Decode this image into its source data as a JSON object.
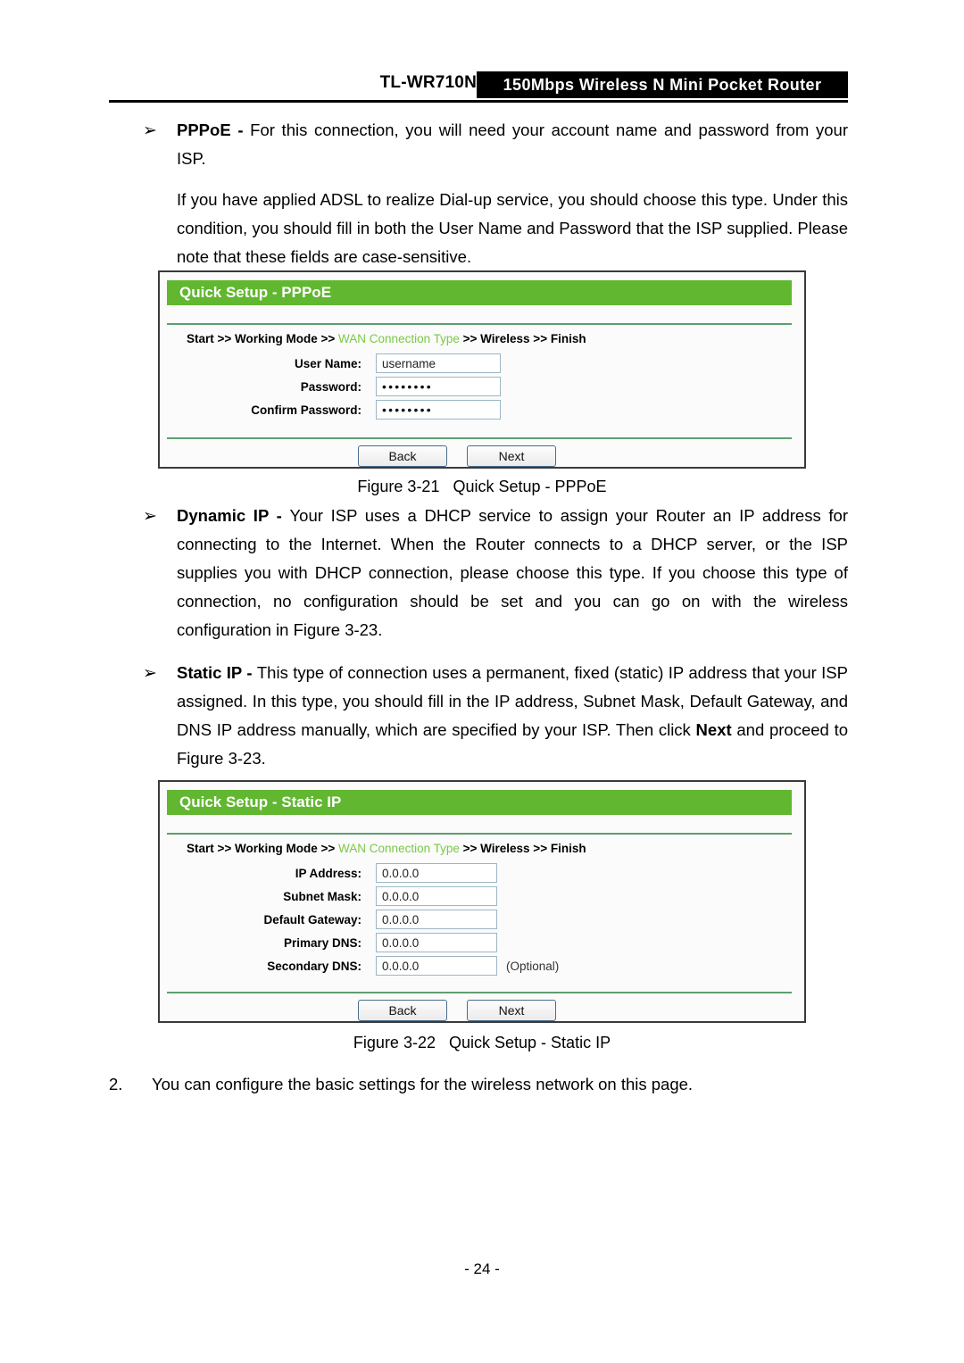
{
  "header": {
    "model": "TL-WR710N",
    "banner": "150Mbps Wireless N Mini Pocket Router"
  },
  "content": {
    "bullet_pppoe_label": "PPPoE - ",
    "bullet_pppoe_text": "For this connection, you will need your account name and password from your ISP.",
    "para_pppoe": "If you have applied ADSL to realize Dial-up service, you should choose this type. Under this condition, you should fill in both the User Name and Password that the ISP supplied. Please note that these fields are case-sensitive.",
    "bullet_dynamic_label": "Dynamic IP - ",
    "bullet_dynamic_text": "Your ISP uses a DHCP service to assign your Router an IP address for connecting to the Internet. When the Router connects to a DHCP server, or the ISP supplies you with DHCP connection, please choose this type. If you choose this type of connection, no configuration should be set and you can go on with the wireless configuration in Figure 3-23.",
    "bullet_static_label": "Static IP - ",
    "bullet_static_text_a": "This type of connection uses a permanent, fixed (static) IP address that your ISP assigned. In this type, you should fill in the IP address, Subnet Mask, Default Gateway, and DNS IP address manually, which are specified by your ISP. Then click ",
    "bullet_static_bold_next": "Next",
    "bullet_static_text_b": " and proceed to Figure 3-23.",
    "item_number": "2.",
    "item_text": "You can configure the basic settings for the wireless network on this page.",
    "page_number": "- 24 -"
  },
  "figure_21": {
    "caption_number": "Figure 3-21",
    "caption_title": "Quick Setup - PPPoE",
    "panel_title": "Quick Setup - PPPoE",
    "breadcrumb": {
      "part1": "Start >> Working Mode >> ",
      "highlight": "WAN Connection Type",
      "part2": " >> Wireless >> Finish"
    },
    "fields": [
      {
        "label": "User Name:",
        "value": "username",
        "type": "text"
      },
      {
        "label": "Password:",
        "value": "••••••••",
        "type": "password"
      },
      {
        "label": "Confirm Password:",
        "value": "••••••••",
        "type": "password"
      }
    ],
    "buttons": {
      "back": "Back",
      "next": "Next"
    }
  },
  "figure_22": {
    "caption_number": "Figure 3-22",
    "caption_title": "Quick Setup - Static IP",
    "panel_title": "Quick Setup - Static IP",
    "breadcrumb": {
      "part1": "Start >> Working Mode >> ",
      "highlight": "WAN Connection Type",
      "part2": " >> Wireless >> Finish"
    },
    "fields": [
      {
        "label": "IP Address:",
        "value": "0.0.0.0",
        "note": ""
      },
      {
        "label": "Subnet Mask:",
        "value": "0.0.0.0",
        "note": ""
      },
      {
        "label": "Default Gateway:",
        "value": "0.0.0.0",
        "note": ""
      },
      {
        "label": "Primary DNS:",
        "value": "0.0.0.0",
        "note": ""
      },
      {
        "label": "Secondary DNS:",
        "value": "0.0.0.0",
        "note": "(Optional)"
      }
    ],
    "buttons": {
      "back": "Back",
      "next": "Next"
    }
  },
  "icons": {
    "bullet_arrow": "➢"
  }
}
